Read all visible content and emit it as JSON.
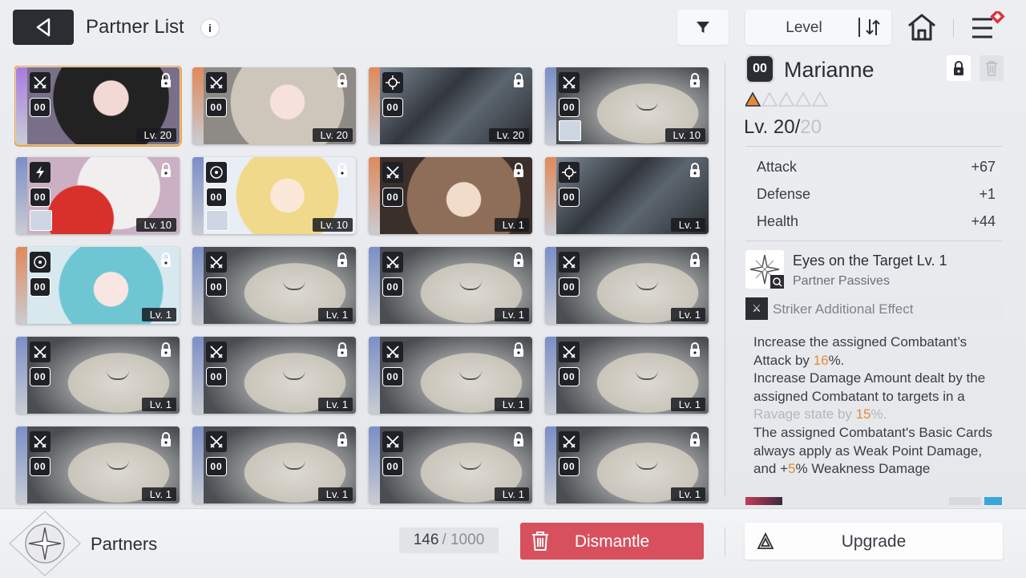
{
  "header": {
    "title": "Partner List",
    "info_icon": "i",
    "sort_label": "Level"
  },
  "partners": [
    {
      "class_icon": "crossed-swords-icon",
      "rank": "00",
      "level": "Lv. 20",
      "art": "art-char1",
      "stripe": "#a87be0",
      "selected": true
    },
    {
      "class_icon": "crossed-swords-icon",
      "rank": "00",
      "level": "Lv. 20",
      "art": "art-char2",
      "stripe": "#e0895a"
    },
    {
      "class_icon": "target-icon",
      "rank": "00",
      "level": "Lv. 20",
      "art": "art-mech",
      "stripe": "#e0895a"
    },
    {
      "class_icon": "crossed-swords-icon",
      "rank": "00",
      "level": "Lv. 10",
      "art": "art-eidolon",
      "stripe": "#7b8fc7",
      "mini": true
    },
    {
      "class_icon": "lightning-icon",
      "rank": "00",
      "level": "Lv. 10",
      "art": "art-wolf",
      "stripe": "#7b8fc7",
      "mini": true
    },
    {
      "class_icon": "circle-icon",
      "rank": "00",
      "level": "Lv. 10",
      "art": "art-blonde",
      "stripe": "#7b8fc7",
      "mini": true
    },
    {
      "class_icon": "crossed-swords-icon",
      "rank": "00",
      "level": "Lv. 1",
      "art": "art-brown",
      "stripe": "#e0895a"
    },
    {
      "class_icon": "target-icon",
      "rank": "00",
      "level": "Lv. 1",
      "art": "art-mech",
      "stripe": "#e0895a"
    },
    {
      "class_icon": "circle-icon",
      "rank": "00",
      "level": "Lv. 1",
      "art": "art-cyan",
      "stripe": "#e0895a"
    },
    {
      "class_icon": "crossed-swords-icon",
      "rank": "00",
      "level": "Lv. 1",
      "art": "art-eidolon",
      "stripe": "#7b8fc7"
    },
    {
      "class_icon": "crossed-swords-icon",
      "rank": "00",
      "level": "Lv. 1",
      "art": "art-eidolon",
      "stripe": "#7b8fc7"
    },
    {
      "class_icon": "crossed-swords-icon",
      "rank": "00",
      "level": "Lv. 1",
      "art": "art-eidolon",
      "stripe": "#7b8fc7"
    },
    {
      "class_icon": "crossed-swords-icon",
      "rank": "00",
      "level": "Lv. 1",
      "art": "art-eidolon",
      "stripe": "#7b8fc7"
    },
    {
      "class_icon": "crossed-swords-icon",
      "rank": "00",
      "level": "Lv. 1",
      "art": "art-eidolon",
      "stripe": "#7b8fc7"
    },
    {
      "class_icon": "crossed-swords-icon",
      "rank": "00",
      "level": "Lv. 1",
      "art": "art-eidolon",
      "stripe": "#7b8fc7"
    },
    {
      "class_icon": "crossed-swords-icon",
      "rank": "00",
      "level": "Lv. 1",
      "art": "art-eidolon",
      "stripe": "#7b8fc7"
    },
    {
      "class_icon": "crossed-swords-icon",
      "rank": "00",
      "level": "Lv. 1",
      "art": "art-eidolon",
      "stripe": "#7b8fc7"
    },
    {
      "class_icon": "crossed-swords-icon",
      "rank": "00",
      "level": "Lv. 1",
      "art": "art-eidolon",
      "stripe": "#7b8fc7"
    },
    {
      "class_icon": "crossed-swords-icon",
      "rank": "00",
      "level": "Lv. 1",
      "art": "art-eidolon",
      "stripe": "#7b8fc7"
    },
    {
      "class_icon": "crossed-swords-icon",
      "rank": "00",
      "level": "Lv. 1",
      "art": "art-eidolon",
      "stripe": "#7b8fc7"
    }
  ],
  "detail": {
    "rank": "00",
    "name": "Marianne",
    "stars_filled": 1,
    "stars_total": 5,
    "level_prefix": "Lv. 20/",
    "level_max": "20",
    "stats": [
      {
        "label": "Attack",
        "value": "+67"
      },
      {
        "label": "Defense",
        "value": "+1"
      },
      {
        "label": "Health",
        "value": "+44"
      }
    ],
    "skill_name": "Eyes on the Target Lv. 1",
    "skill_type": "Partner Passives",
    "striker_label": "Striker Additional Effect",
    "desc_1a": "Increase the assigned Combatant’s Attack by ",
    "desc_1_val": "16",
    "desc_1b": "%.",
    "desc_2a": "Increase Damage Amount dealt by the assigned Combatant to targets in a ",
    "desc_2_dim": "Ravage state by ",
    "desc_2_val": "15",
    "desc_2b": "%.",
    "desc_3a": "The assigned Combatant's Basic Cards always apply as Weak Point Damage, and +",
    "desc_3_val": "5",
    "desc_3b": "% Weakness Damage"
  },
  "footer": {
    "section_label": "Partners",
    "count": "146",
    "count_sep": "/ 1000",
    "dismantle_label": "Dismantle",
    "upgrade_label": "Upgrade"
  },
  "colors": {
    "accent_orange": "#e58a3a",
    "dismantle_red": "#d8505d",
    "selected_outline": "#f2a43a"
  }
}
